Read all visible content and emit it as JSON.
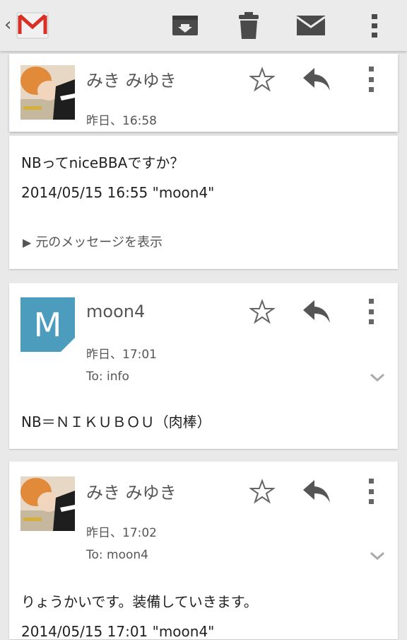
{
  "toolbar": {
    "back": "‹",
    "app_icon": "gmail-envelope-icon",
    "actions": [
      "archive-icon",
      "trash-icon",
      "mark-unread-icon",
      "overflow-menu-icon"
    ],
    "colors": {
      "bar": "#ebebeb",
      "icons": "#444444",
      "gmail_red": "#d93025"
    }
  },
  "messages": [
    {
      "sender": "みき みゆき",
      "date": "昨日、16:58",
      "body": "NBってniceBBAですか？",
      "quote": "2014/05/15 16:55 \"moon4\"",
      "show_original": "元のメッセージを表示"
    },
    {
      "sender": "moon4",
      "avatar_letter": "M",
      "avatar_color": "#4b9cbd",
      "date": "昨日、17:01",
      "to": "To: info",
      "body": "NB＝ＮＩＫＵＢＯＵ（肉棒）"
    },
    {
      "sender": "みき みゆき",
      "date": "昨日、17:02",
      "to": "To: moon4",
      "body": "りょうかいです。装備していきます。",
      "quote": "2014/05/15 17:01 \"moon4\""
    }
  ]
}
